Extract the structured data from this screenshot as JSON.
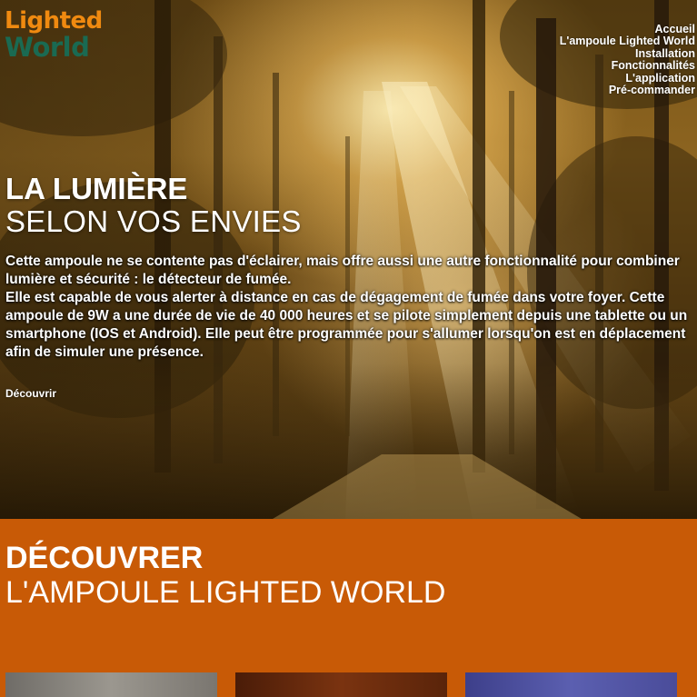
{
  "logo": {
    "line1": "Lighted",
    "line2": "World",
    "color1": "#f08a10",
    "color2": "#1a6a52"
  },
  "nav": {
    "items": [
      "Accueil",
      "L'ampoule Lighted World",
      "Installation",
      "Fonctionnalités",
      "L'application",
      "Pré-commander"
    ]
  },
  "hero": {
    "title_bold": "LA LUMIÈRE",
    "title_light": "SELON VOS ENVIES",
    "paragraph1": "Cette ampoule ne se contente pas d'éclairer, mais offre aussi une autre fonctionnalité pour combiner lumière et sécurité : le détecteur de fumée.",
    "paragraph2": "Elle est capable de vous alerter à distance en cas de dégagement de fumée dans votre foyer. Cette ampoule de 9W a une durée de vie de 40 000 heures et se pilote simplement depuis une tablette ou un smartphone (IOS et Android). Elle peut être programmée pour s'allumer lorsqu'on est en déplacement afin de simuler une présence.",
    "cta": "Découvrir"
  },
  "discover": {
    "title_bold": "DÉCOUVRER",
    "title_light": "L'AMPOULE LIGHTED WORLD",
    "background": "#c85a06"
  }
}
